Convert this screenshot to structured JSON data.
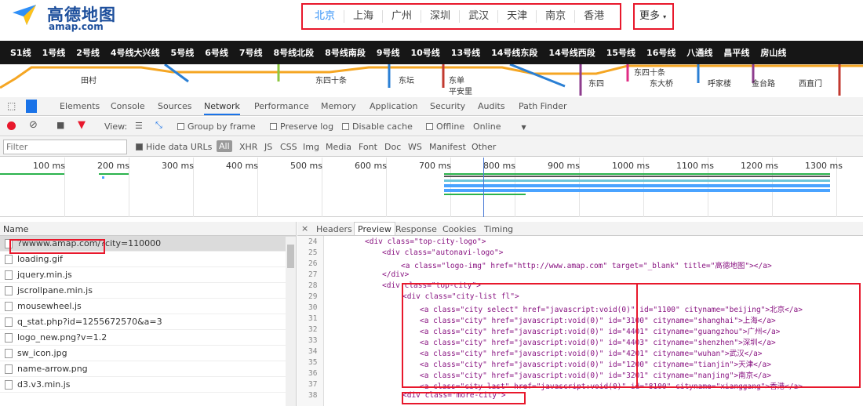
{
  "header": {
    "logo_cn": "高德地图",
    "logo_en": "amap.com",
    "cities": [
      "北京",
      "上海",
      "广州",
      "深圳",
      "武汉",
      "天津",
      "南京",
      "香港"
    ],
    "more_label": "更多"
  },
  "subway": {
    "lines": [
      "S1线",
      "1号线",
      "2号线",
      "4号线大兴线",
      "5号线",
      "6号线",
      "7号线",
      "8号线北段",
      "8号线南段",
      "9号线",
      "10号线",
      "13号线",
      "14号线东段",
      "14号线西段",
      "15号线",
      "16号线",
      "八通线",
      "昌平线",
      "房山线"
    ],
    "stations": [
      "田村",
      "东四十条",
      "东坛",
      "东单",
      "平安里",
      "东四",
      "东四十条",
      "东大桥",
      "呼家楼",
      "金台路",
      "西直门"
    ]
  },
  "devtools": {
    "tabs": [
      "Elements",
      "Console",
      "Sources",
      "Network",
      "Performance",
      "Memory",
      "Application",
      "Security",
      "Audits",
      "Path Finder"
    ],
    "active_tab": "Network",
    "toolbar": {
      "view": "View:",
      "group_by_frame": "Group by frame",
      "preserve_log": "Preserve log",
      "disable_cache": "Disable cache",
      "offline": "Offline",
      "online": "Online"
    },
    "filter": {
      "placeholder": "Filter",
      "hide_data_urls": "Hide data URLs",
      "all": "All",
      "types": [
        "XHR",
        "JS",
        "CSS",
        "Img",
        "Media",
        "Font",
        "Doc",
        "WS",
        "Manifest",
        "Other"
      ]
    },
    "timeline_ticks": [
      "100 ms",
      "200 ms",
      "300 ms",
      "400 ms",
      "500 ms",
      "600 ms",
      "700 ms",
      "800 ms",
      "900 ms",
      "1000 ms",
      "1100 ms",
      "1200 ms",
      "1300 ms"
    ],
    "requests": {
      "header": "Name",
      "rows": [
        "?wwww.amap.com/?city=110000",
        "loading.gif",
        "jquery.min.js",
        "jscrollpane.min.js",
        "mousewheel.js",
        "q_stat.php?id=1255672570&a=3",
        "logo_new.png?v=1.2",
        "sw_icon.jpg",
        "name-arrow.png",
        "d3.v3.min.js"
      ]
    },
    "preview": {
      "tabs": [
        "Headers",
        "Preview",
        "Response",
        "Cookies",
        "Timing"
      ],
      "active_tab": "Preview",
      "line_numbers": [
        "24",
        "25",
        "26",
        "27",
        "28",
        "29",
        "30",
        "31",
        "32",
        "33",
        "34",
        "35",
        "36",
        "37",
        "38"
      ],
      "lines": [
        "<div class=\"top-city-logo\">",
        "<div class=\"autonavi-logo\">",
        "<a class=\"logo-img\" href=\"http://www.amap.com\" target=\"_blank\" title=\"高德地图\"></a>",
        "</div>",
        "<div class=\"top-city\">",
        "<div class=\"city-list fl\">",
        "<a class=\"city select\" href=\"javascript:void(0)\" id=\"1100\" cityname=\"beijing\">北京</a>",
        "<a class=\"city\" href=\"javascript:void(0)\" id=\"3100\" cityname=\"shanghai\">上海</a>",
        "<a class=\"city\" href=\"javascript:void(0)\" id=\"4401\" cityname=\"guangzhou\">广州</a>",
        "<a class=\"city\" href=\"javascript:void(0)\" id=\"4403\" cityname=\"shenzhen\">深圳</a>",
        "<a class=\"city\" href=\"javascript:void(0)\" id=\"4201\" cityname=\"wuhan\">武汉</a>",
        "<a class=\"city\" href=\"javascript:void(0)\" id=\"1200\" cityname=\"tianjin\">天津</a>",
        "<a class=\"city\" href=\"javascript:void(0)\" id=\"3201\" cityname=\"nanjing\">南京</a>",
        "<a class=\"city last\" href=\"javascript:void(0)\" id=\"8100\" cityname=\"xianggang\">香港</a>",
        "<div class=\"more-city\">"
      ]
    }
  },
  "colors": {
    "highlight": "#e8182c",
    "brand": "#1d4f9c",
    "selected_city": "#2f8ff7"
  }
}
